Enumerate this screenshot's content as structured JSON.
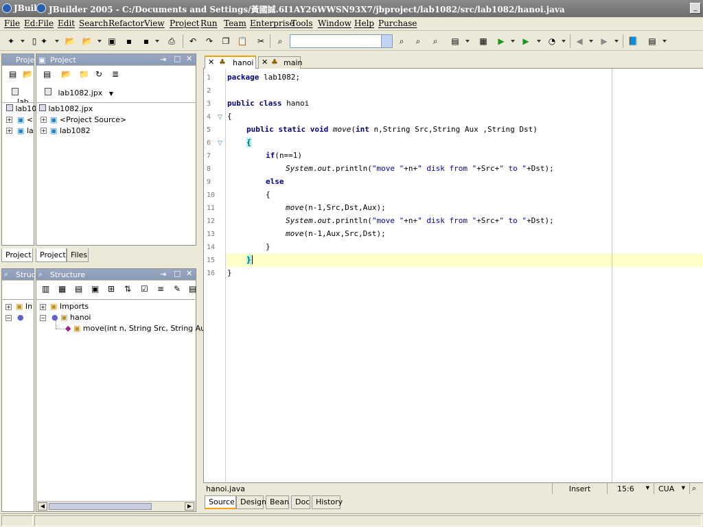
{
  "window": {
    "app_short": "JBuil",
    "title": "JBuilder 2005 - C:/Documents and Settings/黃國誠.6I1AY26WWSN93X7/jbproject/lab1082/src/lab1082/hanoi.java"
  },
  "menu": [
    "File",
    "Edit",
    "File",
    "Edit",
    "Search",
    "Refactor",
    "View",
    "Project",
    "Run",
    "Team",
    "Enterprise",
    "Tools",
    "Window",
    "Help",
    "Purchase"
  ],
  "menu_display": {
    "m0": "File",
    "m1": "Ed:",
    "m2": "File",
    "m3": "Edit",
    "m4": "Search",
    "m5": "Refactor",
    "m6": "View",
    "m7": "Project",
    "m8": "Run",
    "m9": "Team",
    "m10": "Enterprise",
    "m11": "Tools",
    "m12": "Window",
    "m13": "Help",
    "m14": "Purchase"
  },
  "project_panel": {
    "left_title": "Proje",
    "title": "Project",
    "left_selector": "lab",
    "selector": "lab1082.jpx",
    "left_root": "lab10",
    "root": "lab1082.jpx",
    "items": [
      "<Project Source>",
      "lab1082"
    ],
    "left_items": [
      "<",
      "la"
    ],
    "tabs": {
      "left": "Project",
      "project": "Project",
      "files": "Files"
    }
  },
  "structure_panel": {
    "left_title": "Struc",
    "title": "Structure",
    "imports": "Imports",
    "left_imports": "In",
    "class": "hanoi",
    "method": "move(int n, String Src, String Aux"
  },
  "editor": {
    "tabs": [
      {
        "label": "hanoi"
      },
      {
        "label": "main"
      }
    ],
    "line_numbers": [
      "1",
      "2",
      "3",
      "4",
      "5",
      "6",
      "7",
      "8",
      "9",
      "10",
      "11",
      "12",
      "13",
      "14",
      "15",
      "16"
    ],
    "filename": "hanoi.java",
    "mode": "Insert",
    "position": "15:6",
    "keymap": "CUA",
    "bottom_tabs": [
      "Source",
      "Design",
      "Bean",
      "Doc",
      "History"
    ]
  },
  "code": {
    "l1_kw": "package",
    "l1": " lab1082;",
    "l3_kw": "public class",
    "l3": " hanoi",
    "l4": "{",
    "l5_kw1": "public static void",
    "l5_m": "move",
    "l5_a": "(",
    "l5_kw2": "int",
    "l5_b": " n,String Src,String Aux ,String Dst)",
    "l6": "{",
    "l7_kw": "if",
    "l7": "(n==1)",
    "l8_cls": "System",
    "l8_dot": ".",
    "l8_out": "out",
    "l8_a": ".println(",
    "l8_s1": "\"move \"",
    "l8_b": "+n+",
    "l8_s2": "\" disk from \"",
    "l8_c": "+Src+",
    "l8_s3": "\" to \"",
    "l8_d": "+Dst);",
    "l9_kw": "else",
    "l10": "{",
    "l11_m": "move",
    "l11": "(n-1,Src,Dst,Aux);",
    "l12_cls": "System",
    "l12_dot": ".",
    "l12_out": "out",
    "l12_a": ".println(",
    "l12_s1": "\"move \"",
    "l12_b": "+n+",
    "l12_s2": "\" disk from \"",
    "l12_c": "+Src+",
    "l12_s3": "\" to \"",
    "l12_d": "+Dst);",
    "l13_m": "move",
    "l13": "(n-1,Aux,Src,Dst);",
    "l14": "}",
    "l15": "}",
    "l16": "}"
  },
  "colors": {
    "keyword": "#000080",
    "string": "#0000c0",
    "current_line": "#ffffc8",
    "brace_highlight": "#80ffff"
  }
}
